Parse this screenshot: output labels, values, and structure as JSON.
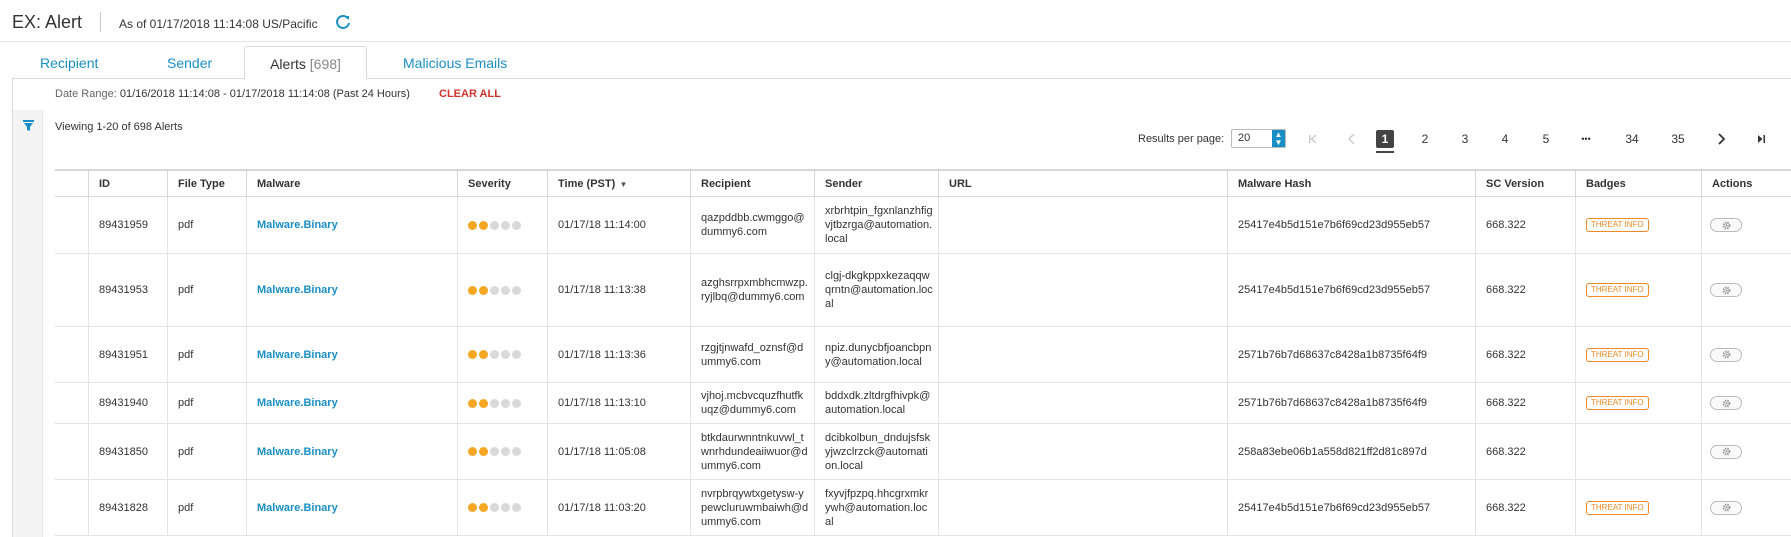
{
  "header": {
    "title": "EX: Alert",
    "as_of": "As of 01/17/2018 11:14:08 US/Pacific",
    "refresh_icon": "refresh-icon"
  },
  "tabs": [
    {
      "label": "Recipient",
      "count": ""
    },
    {
      "label": "Sender",
      "count": ""
    },
    {
      "label": "Alerts",
      "count": "[698]"
    },
    {
      "label": "Malicious Emails",
      "count": ""
    }
  ],
  "filters": {
    "date_range_label": "Date Range:",
    "date_range_value": "01/16/2018 11:14:08 - 01/17/2018 11:14:08 (Past 24 Hours)",
    "clear_all": "CLEAR ALL",
    "filter_icon": "filter-icon"
  },
  "viewing": "Viewing 1-20 of 698 Alerts",
  "pagination": {
    "results_label": "Results per page:",
    "results_value": "20",
    "pages": [
      "1",
      "2",
      "3",
      "4",
      "5",
      "•••",
      "34",
      "35"
    ],
    "current_page": "1"
  },
  "columns": [
    "ID",
    "File Type",
    "Malware",
    "Severity",
    "Time (PST)",
    "Recipient",
    "Sender",
    "URL",
    "Malware Hash",
    "SC Version",
    "Badges",
    "Actions"
  ],
  "severity_colors": {
    "on": "#f5a623",
    "off": "#d9d9d9"
  },
  "rows": [
    {
      "id": "89431959",
      "file_type": "pdf",
      "malware": "Malware.Binary",
      "severity": 2,
      "time": "01/17/18 11:14:00",
      "recipient": "qazpddbb.cwmggo@dummy6.com",
      "sender": "xrbrhtpin_fgxnlanzhfigvjtbzrga@automation.local",
      "url": "",
      "hash": "25417e4b5d151e7b6f69cd23d955eb57",
      "sc_version": "668.322",
      "badge": "THREAT INFO"
    },
    {
      "id": "89431953",
      "file_type": "pdf",
      "malware": "Malware.Binary",
      "severity": 2,
      "time": "01/17/18 11:13:38",
      "recipient": "azghsrrpxmbhcmwzp.ryjlbq@dummy6.com",
      "sender": "clgj-dkgkppxkezaqqwqrntn@automation.local",
      "url": "",
      "hash": "25417e4b5d151e7b6f69cd23d955eb57",
      "sc_version": "668.322",
      "badge": "THREAT INFO"
    },
    {
      "id": "89431951",
      "file_type": "pdf",
      "malware": "Malware.Binary",
      "severity": 2,
      "time": "01/17/18 11:13:36",
      "recipient": "rzgjtjnwafd_oznsf@dummy6.com",
      "sender": "npiz.dunycbfjoancbpny@automation.local",
      "url": "",
      "hash": "2571b76b7d68637c8428a1b8735f64f9",
      "sc_version": "668.322",
      "badge": "THREAT INFO"
    },
    {
      "id": "89431940",
      "file_type": "pdf",
      "malware": "Malware.Binary",
      "severity": 2,
      "time": "01/17/18 11:13:10",
      "recipient": "vjhoj.mcbvcquzfhutfkuqz@dummy6.com",
      "sender": "bddxdk.zltdrgfhivpk@automation.local",
      "url": "",
      "hash": "2571b76b7d68637c8428a1b8735f64f9",
      "sc_version": "668.322",
      "badge": "THREAT INFO"
    },
    {
      "id": "89431850",
      "file_type": "pdf",
      "malware": "Malware.Binary",
      "severity": 2,
      "time": "01/17/18 11:05:08",
      "recipient": "btkdaurwnntnkuvwl_twnrhdundeaiiwuor@dummy6.com",
      "sender": "dcibkolbun_dndujsfskyjwzclrzck@automation.local",
      "url": "",
      "hash": "258a83ebe06b1a558d821ff2d81c897d",
      "sc_version": "668.322",
      "badge": ""
    },
    {
      "id": "89431828",
      "file_type": "pdf",
      "malware": "Malware.Binary",
      "severity": 2,
      "time": "01/17/18 11:03:20",
      "recipient": "nvrpbrqywtxgetysw-ypewcluruwmbaiwh@dummy6.com",
      "sender": "fxyvjfpzpq.hhcgrxmkrywh@automation.local",
      "url": "",
      "hash": "25417e4b5d151e7b6f69cd23d955eb57",
      "sc_version": "668.322",
      "badge": "THREAT INFO"
    }
  ],
  "icons": {
    "action": "gear-icon",
    "first": "first-page-icon",
    "prev": "prev-page-icon",
    "next": "next-page-icon",
    "last": "last-page-icon"
  }
}
